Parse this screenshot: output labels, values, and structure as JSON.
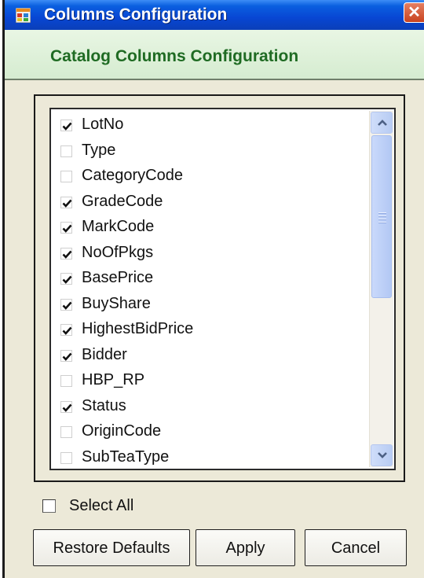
{
  "window": {
    "title": "Columns Configuration",
    "close_symbol": "✕",
    "header_title": "Catalog Columns Configuration"
  },
  "columns": [
    {
      "label": "LotNo",
      "checked": true
    },
    {
      "label": "Type",
      "checked": false
    },
    {
      "label": "CategoryCode",
      "checked": false
    },
    {
      "label": "GradeCode",
      "checked": true
    },
    {
      "label": "MarkCode",
      "checked": true
    },
    {
      "label": "NoOfPkgs",
      "checked": true
    },
    {
      "label": "BasePrice",
      "checked": true
    },
    {
      "label": "BuyShare",
      "checked": true
    },
    {
      "label": "HighestBidPrice",
      "checked": true
    },
    {
      "label": "Bidder",
      "checked": true
    },
    {
      "label": "HBP_RP",
      "checked": false
    },
    {
      "label": "Status",
      "checked": true
    },
    {
      "label": "OriginCode",
      "checked": false
    },
    {
      "label": "SubTeaType",
      "checked": false
    }
  ],
  "select_all": {
    "label": "Select All",
    "checked": false
  },
  "buttons": {
    "restore_defaults": "Restore Defaults",
    "apply": "Apply",
    "cancel": "Cancel"
  },
  "colors": {
    "titlebar": "#0846d3",
    "header_text": "#1f6b23",
    "header_bg": "#e3f3de"
  }
}
